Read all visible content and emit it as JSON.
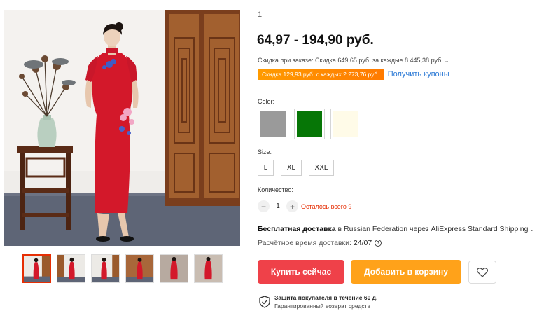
{
  "gallery": {
    "main_alt": "red-qipao-dress-photo",
    "thumbnail_count": 6,
    "active_index": 0
  },
  "product": {
    "sku_fragment": "1",
    "price_range": "64,97 - 194,90 руб.",
    "bulk_discount": "Скидка при заказе: Скидка 649,65 руб. за каждые 8 445,38 руб.",
    "coupon_badge": "Скидка 129,93 руб. с каждых 2 273,76 руб.",
    "coupon_link": "Получить купоны"
  },
  "options": {
    "color_label": "Color:",
    "colors": [
      "#9a9a9a",
      "#067606",
      "#fffbe8"
    ],
    "size_label": "Size:",
    "sizes": [
      "L",
      "XL",
      "XXL"
    ]
  },
  "quantity": {
    "label": "Количество:",
    "minus": "−",
    "value": "1",
    "plus": "+",
    "left_text": "Осталось всего 9"
  },
  "shipping": {
    "free_label": "Бесплатная доставка",
    "details": " в Russian Federation через AliExpress Standard Shipping",
    "eta_label": "Расчётное время доставки:",
    "eta_date": "24/07"
  },
  "actions": {
    "buy_now": "Купить сейчас",
    "add_to_cart": "Добавить в корзину"
  },
  "protection": {
    "title": "Защита покупателя в течение 60 д.",
    "subtitle": "Гарантированный возврат средств"
  },
  "colors": {
    "accent_red": "#ef4149",
    "accent_orange": "#ffa21a",
    "link_blue": "#2e7bd6"
  }
}
